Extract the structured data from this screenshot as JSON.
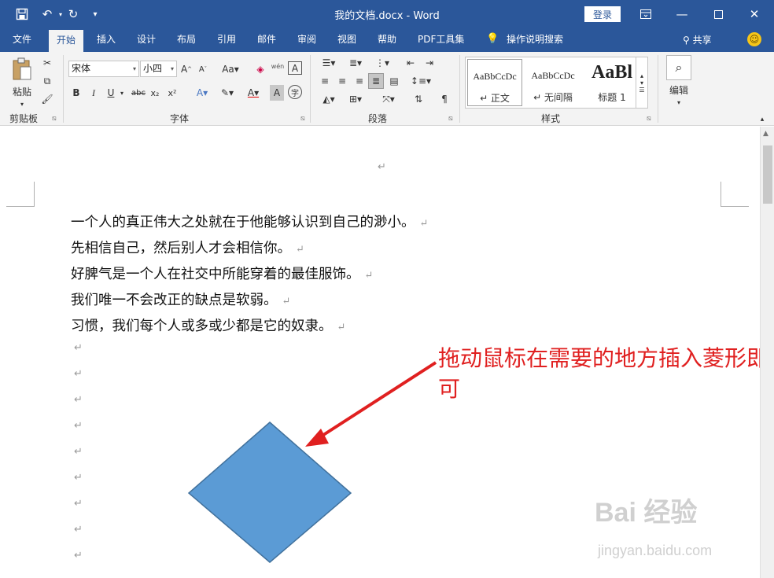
{
  "window": {
    "title": "我的文档.docx  -  Word",
    "login_label": "登录"
  },
  "tabs": [
    {
      "label": "文件"
    },
    {
      "label": "开始"
    },
    {
      "label": "插入"
    },
    {
      "label": "设计"
    },
    {
      "label": "布局"
    },
    {
      "label": "引用"
    },
    {
      "label": "邮件"
    },
    {
      "label": "审阅"
    },
    {
      "label": "视图"
    },
    {
      "label": "帮助"
    },
    {
      "label": "PDF工具集"
    },
    {
      "label": "操作说明搜索"
    }
  ],
  "share_label": "共享",
  "ribbon": {
    "clipboard": {
      "paste_label": "粘贴",
      "group_label": "剪贴板"
    },
    "font": {
      "font_name": "宋体",
      "font_size": "小四",
      "group_label": "字体",
      "wen_label": "wén"
    },
    "paragraph": {
      "group_label": "段落"
    },
    "styles": {
      "group_label": "样式",
      "items": [
        {
          "preview": "AaBbCcDc",
          "name": "↵ 正文"
        },
        {
          "preview": "AaBbCcDc",
          "name": "↵ 无间隔"
        },
        {
          "preview": "AaBl",
          "name": "标题 1"
        }
      ]
    },
    "editing": {
      "label": "编辑"
    }
  },
  "document": {
    "lines": [
      "一个人的真正伟大之处就在于他能够认识到自己的渺小。",
      "先相信自己，然后别人才会相信你。",
      "好脾气是一个人在社交中所能穿着的最佳服饰。",
      "我们唯一不会改正的缺点是软弱。",
      "习惯，我们每个人或多或少都是它的奴隶。"
    ],
    "paragraph_mark": "↵",
    "shape": {
      "type": "diamond",
      "fill": "#5b9bd5",
      "stroke": "#41719c"
    }
  },
  "annotation": {
    "text": "拖动鼠标在需要的地方插入菱形即可",
    "color": "#e02020"
  },
  "watermark": {
    "text": "Bai 经验",
    "url": "jingyan.baidu.com"
  }
}
